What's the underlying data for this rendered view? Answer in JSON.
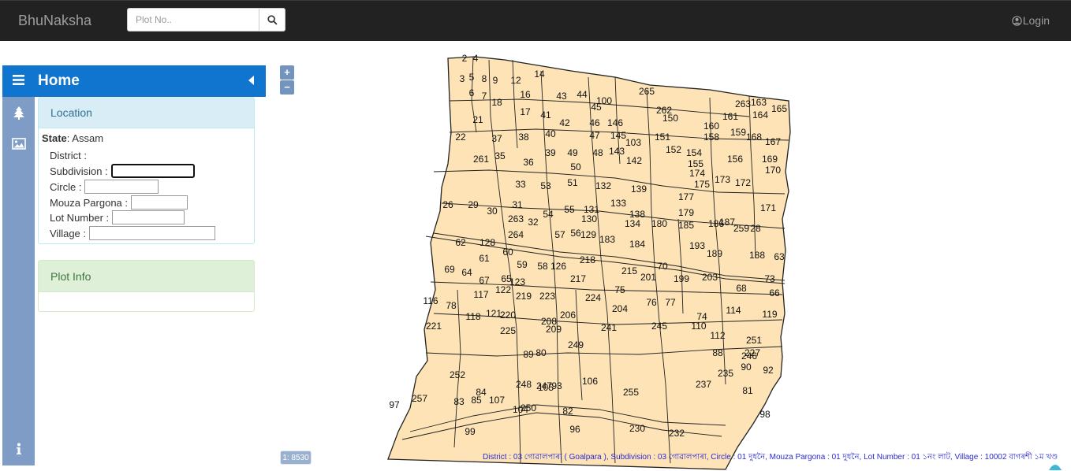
{
  "navbar": {
    "brand": "BhuNaksha",
    "search_placeholder": "Plot No..",
    "login_label": "Login"
  },
  "sidebar": {
    "title": "Home",
    "icons": [
      "menu-icon",
      "tree-icon",
      "image-icon",
      "info-icon",
      "collapse-left-icon"
    ],
    "location_panel": {
      "heading": "Location",
      "state_label": "State",
      "state_value": ": Assam",
      "fields": [
        {
          "label": "District :"
        },
        {
          "label": "Subdivision :"
        },
        {
          "label": "Circle :"
        },
        {
          "label": "Mouza Pargona :"
        },
        {
          "label": "Lot Number :"
        },
        {
          "label": "Village :"
        }
      ]
    },
    "plot_panel": {
      "heading": "Plot Info"
    }
  },
  "map": {
    "zoom_in": "+",
    "zoom_out": "−",
    "scale": "1: 8530",
    "fill_color": "#fde3b5",
    "stroke_color": "#222222",
    "footer": "District : 03 গোৱালপাৰা ( Goalpara ), Subdivision : 03 গোৱালপাৰা, Circle : 01 দুধনৈ, Mouza Pargona : 01 দুধনৈ, Lot Number : 01 ১নং লাট, Village : 10002 বাগৰশী ১ম খণ্ড",
    "plot_numbers": [
      "2",
      "4",
      "3",
      "5",
      "8",
      "9",
      "12",
      "14",
      "6",
      "7",
      "18",
      "16",
      "43",
      "44",
      "45",
      "265",
      "263",
      "163",
      "164",
      "165",
      "21",
      "17",
      "41",
      "42",
      "46",
      "146",
      "262",
      "150",
      "161",
      "160",
      "158",
      "159",
      "22",
      "37",
      "38",
      "40",
      "47",
      "145",
      "151",
      "168",
      "167",
      "261",
      "35",
      "39",
      "49",
      "48",
      "143",
      "142",
      "152",
      "154",
      "156",
      "169",
      "36",
      "50",
      "155",
      "174",
      "170",
      "33",
      "53",
      "51",
      "132",
      "139",
      "177",
      "175",
      "173",
      "172",
      "26",
      "29",
      "30",
      "31",
      "54",
      "55",
      "131",
      "130",
      "133",
      "138",
      "179",
      "171",
      "263",
      "32",
      "264",
      "57",
      "56",
      "129",
      "134",
      "180",
      "185",
      "186",
      "187",
      "259",
      "28",
      "62",
      "128",
      "183",
      "184",
      "193",
      "189",
      "188",
      "63",
      "61",
      "60",
      "59",
      "58",
      "126",
      "218",
      "215",
      "70",
      "69",
      "64",
      "67",
      "65",
      "123",
      "217",
      "201",
      "199",
      "203",
      "73",
      "68",
      "66",
      "116",
      "117",
      "122",
      "219",
      "223",
      "224",
      "75",
      "76",
      "77",
      "78",
      "118",
      "121",
      "220",
      "208",
      "206",
      "204",
      "74",
      "114",
      "119",
      "221",
      "225",
      "209",
      "241",
      "245",
      "110",
      "112",
      "251",
      "249",
      "89",
      "227",
      "246",
      "80",
      "88",
      "90",
      "92",
      "252",
      "248",
      "247",
      "93",
      "106",
      "237",
      "235",
      "255",
      "81",
      "84",
      "85",
      "107",
      "250",
      "82",
      "98",
      "99",
      "230",
      "232",
      "257",
      "83",
      "97",
      "104",
      "105",
      "96",
      "100",
      "103"
    ]
  }
}
